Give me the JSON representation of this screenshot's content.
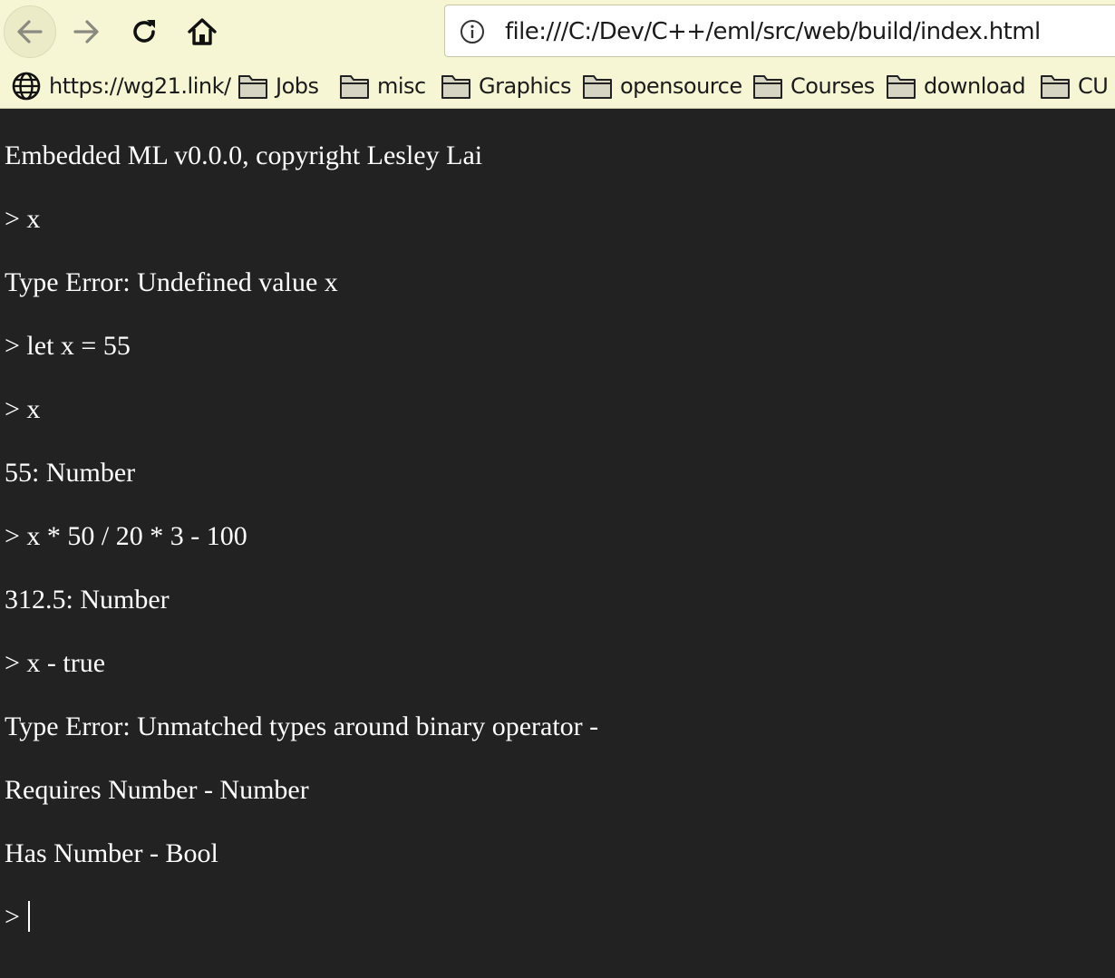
{
  "browser": {
    "url": "file:///C:/Dev/C++/eml/src/web/build/index.html",
    "nav_icons": {
      "back": "arrow-left-icon",
      "forward": "arrow-right-icon",
      "reload": "reload-icon",
      "home": "home-icon",
      "info": "info-icon"
    },
    "bookmarks": [
      {
        "label": "https://wg21.link/",
        "icon": "globe-icon"
      },
      {
        "label": "Jobs",
        "icon": "folder-icon"
      },
      {
        "label": "misc",
        "icon": "folder-icon"
      },
      {
        "label": "Graphics",
        "icon": "folder-icon"
      },
      {
        "label": "opensource",
        "icon": "folder-icon"
      },
      {
        "label": "Courses",
        "icon": "folder-icon"
      },
      {
        "label": "download",
        "icon": "folder-icon"
      },
      {
        "label": "CU",
        "icon": "folder-icon"
      }
    ],
    "chrome_color": "#f7f6d4"
  },
  "console": {
    "background_color": "#222222",
    "text_color": "#ffffff",
    "lines": [
      "Embedded ML v0.0.0, copyright Lesley Lai",
      "> x",
      "Type Error: Undefined value x",
      "> let x = 55",
      "> x",
      "55: Number",
      "> x * 50 / 20 * 3 - 100",
      "312.5: Number",
      "> x - true",
      "Type Error: Unmatched types around binary operator -",
      "Requires Number - Number",
      "Has Number - Bool"
    ],
    "prompt": "> "
  }
}
